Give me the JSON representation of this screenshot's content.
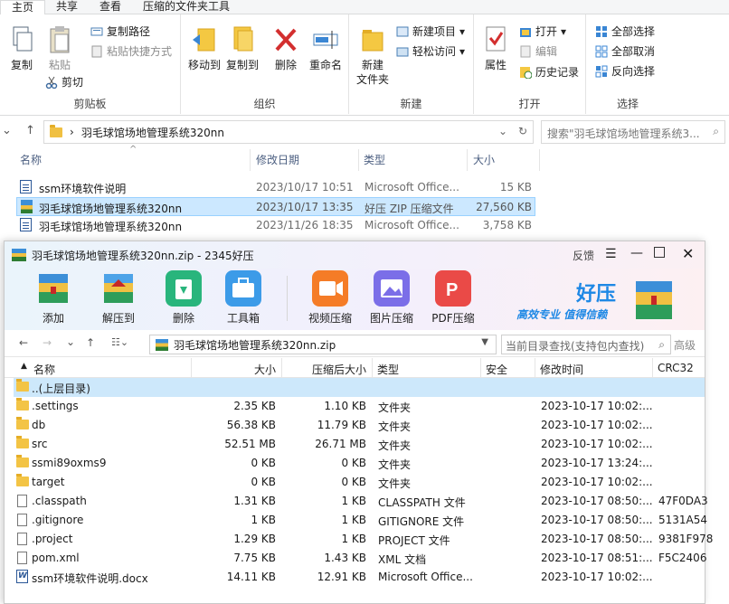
{
  "ribbon": {
    "tabs": [
      "主页",
      "共享",
      "查看",
      "压缩的文件夹工具"
    ],
    "clipboard": {
      "copy": "复制",
      "paste": "粘贴",
      "copy_path": "复制路径",
      "paste_shortcut": "粘贴快捷方式",
      "cut": "剪切",
      "group": "剪贴板"
    },
    "organize": {
      "move_to": "移动到",
      "copy_to": "复制到",
      "delete": "删除",
      "rename": "重命名",
      "group": "组织"
    },
    "new": {
      "new_folder_1": "新建",
      "new_folder_2": "文件夹",
      "new_item": "新建项目",
      "easy_access": "轻松访问",
      "group": "新建"
    },
    "open": {
      "properties": "属性",
      "open": "打开",
      "edit": "编辑",
      "history": "历史记录",
      "group": "打开"
    },
    "select": {
      "select_all": "全部选择",
      "select_none": "全部取消",
      "invert": "反向选择",
      "group": "选择"
    }
  },
  "address": {
    "path": "羽毛球馆场地管理系统320nn",
    "search_placeholder": "搜索\"羽毛球馆场地管理系统3..."
  },
  "explorer": {
    "columns": {
      "name": "名称",
      "date": "修改日期",
      "type": "类型",
      "size": "大小"
    },
    "rows": [
      {
        "name": "ssm环境软件说明",
        "date": "2023/10/17 10:51",
        "type": "Microsoft Office...",
        "size": "15 KB"
      },
      {
        "name": "羽毛球馆场地管理系统320nn",
        "date": "2023/10/17 13:35",
        "type": "好压 ZIP 压缩文件",
        "size": "27,560 KB"
      },
      {
        "name": "羽毛球馆场地管理系统320nn",
        "date": "2023/11/26 18:35",
        "type": "Microsoft Office...",
        "size": "3,758 KB"
      }
    ]
  },
  "zip": {
    "title": "羽毛球馆场地管理系统320nn.zip - 2345好压",
    "feedback": "反馈",
    "toolbar": {
      "add": "添加",
      "extract": "解压到",
      "delete": "删除",
      "tools": "工具箱",
      "video": "视频压缩",
      "image": "图片压缩",
      "pdf": "PDF压缩"
    },
    "brand": {
      "name": "好压",
      "slogan1": "高效专业",
      "slogan2": "值得信赖"
    },
    "path": "羽毛球馆场地管理系统320nn.zip",
    "search_placeholder": "当前目录查找(支持包内查找)",
    "advanced": "高级",
    "columns": {
      "name": "名称",
      "size": "大小",
      "packed": "压缩后大小",
      "type": "类型",
      "secure": "安全",
      "mtime": "修改时间",
      "crc": "CRC32"
    },
    "rows": [
      {
        "kind": "folder",
        "name": "..(上层目录)",
        "size": "",
        "packed": "",
        "type": "",
        "mtime": "",
        "crc": ""
      },
      {
        "kind": "folder",
        "name": ".settings",
        "size": "2.35 KB",
        "packed": "1.10 KB",
        "type": "文件夹",
        "mtime": "2023-10-17 10:02:...",
        "crc": ""
      },
      {
        "kind": "folder",
        "name": "db",
        "size": "56.38 KB",
        "packed": "11.79 KB",
        "type": "文件夹",
        "mtime": "2023-10-17 10:02:...",
        "crc": ""
      },
      {
        "kind": "folder",
        "name": "src",
        "size": "52.51 MB",
        "packed": "26.71 MB",
        "type": "文件夹",
        "mtime": "2023-10-17 10:02:...",
        "crc": ""
      },
      {
        "kind": "folder",
        "name": "ssmi89oxms9",
        "size": "0 KB",
        "packed": "0 KB",
        "type": "文件夹",
        "mtime": "2023-10-17 13:24:...",
        "crc": ""
      },
      {
        "kind": "folder",
        "name": "target",
        "size": "0 KB",
        "packed": "0 KB",
        "type": "文件夹",
        "mtime": "2023-10-17 10:02:...",
        "crc": ""
      },
      {
        "kind": "file",
        "name": ".classpath",
        "size": "1.31 KB",
        "packed": "1 KB",
        "type": "CLASSPATH 文件",
        "mtime": "2023-10-17 08:50:...",
        "crc": "47F0DA3"
      },
      {
        "kind": "file",
        "name": ".gitignore",
        "size": "1 KB",
        "packed": "1 KB",
        "type": "GITIGNORE 文件",
        "mtime": "2023-10-17 08:50:...",
        "crc": "5131A54"
      },
      {
        "kind": "file",
        "name": ".project",
        "size": "1.29 KB",
        "packed": "1 KB",
        "type": "PROJECT 文件",
        "mtime": "2023-10-17 08:50:...",
        "crc": "9381F978"
      },
      {
        "kind": "file",
        "name": "pom.xml",
        "size": "7.75 KB",
        "packed": "1.43 KB",
        "type": "XML 文档",
        "mtime": "2023-10-17 08:51:...",
        "crc": "F5C2406"
      },
      {
        "kind": "word",
        "name": "ssm环境软件说明.docx",
        "size": "14.11 KB",
        "packed": "12.91 KB",
        "type": "Microsoft Office...",
        "mtime": "2023-10-17 10:02:...",
        "crc": ""
      }
    ]
  }
}
